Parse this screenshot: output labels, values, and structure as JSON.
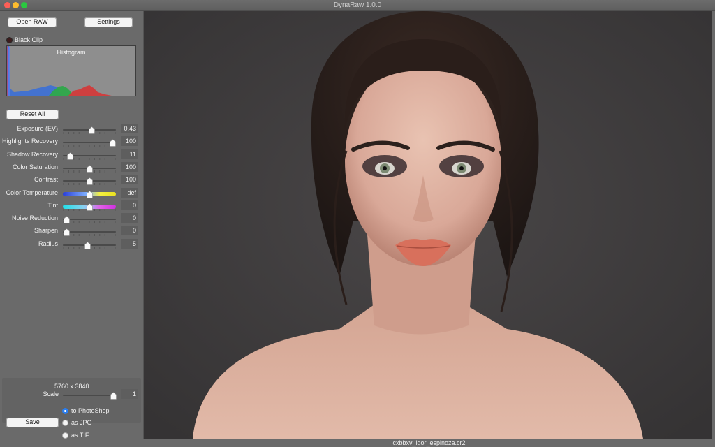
{
  "window": {
    "title": "DynaRaw 1.0.0"
  },
  "toolbar": {
    "open_label": "Open RAW",
    "settings_label": "Settings"
  },
  "black_clip": {
    "label": "Black Clip"
  },
  "histogram": {
    "title": "Histogram"
  },
  "reset_label": "Reset All",
  "sliders": [
    {
      "id": "exposure",
      "label": "Exposure (EV)",
      "value": "0.43",
      "pos": 0.54,
      "ticks": true
    },
    {
      "id": "highlights",
      "label": "Highlights Recovery",
      "value": "100",
      "pos": 0.93,
      "ticks": true
    },
    {
      "id": "shadow",
      "label": "Shadow Recovery",
      "value": "11",
      "pos": 0.13,
      "ticks": true
    },
    {
      "id": "saturation",
      "label": "Color Saturation",
      "value": "100",
      "pos": 0.5,
      "ticks": true
    },
    {
      "id": "contrast",
      "label": "Contrast",
      "value": "100",
      "pos": 0.5,
      "ticks": true
    },
    {
      "id": "temperature",
      "label": "Color Temperature",
      "value": "def",
      "pos": 0.5,
      "ticks": false,
      "gradient": "temperature"
    },
    {
      "id": "tint",
      "label": "Tint",
      "value": "0",
      "pos": 0.5,
      "ticks": true,
      "gradient": "tint"
    },
    {
      "id": "noise",
      "label": "Noise Reduction",
      "value": "0",
      "pos": 0.06,
      "ticks": true
    },
    {
      "id": "sharpen",
      "label": "Sharpen",
      "value": "0",
      "pos": 0.06,
      "ticks": true
    },
    {
      "id": "radius",
      "label": "Radius",
      "value": "5",
      "pos": 0.46,
      "ticks": true
    }
  ],
  "output": {
    "dimensions": "5760 x 3840",
    "scale_label": "Scale",
    "scale_value": "1",
    "scale_pos": 0.95,
    "save_label": "Save",
    "targets": [
      {
        "label": "to PhotoShop",
        "selected": true
      },
      {
        "label": "as JPG",
        "selected": false
      },
      {
        "label": "as TIF",
        "selected": false
      }
    ]
  },
  "status": {
    "filename": "cxbbxv_igor_espinoza.cr2"
  },
  "colors": {
    "panel": "#6a6a6a",
    "viewer_bg": "#3f3d3e",
    "accent": "#2a7ef0"
  }
}
